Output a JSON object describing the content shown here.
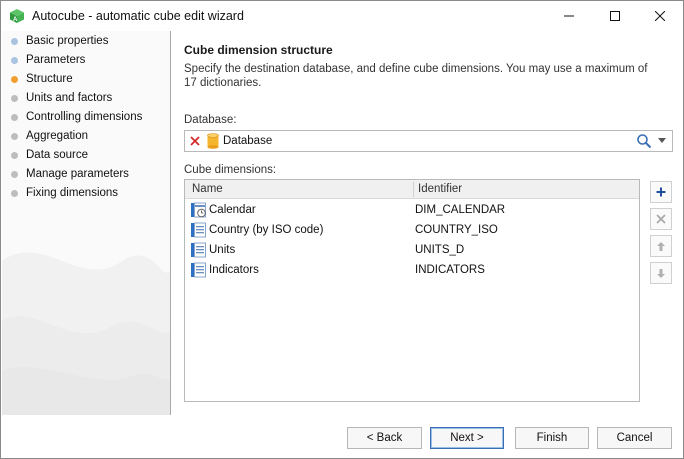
{
  "window": {
    "title": "Autocube - automatic cube edit wizard",
    "controls": [
      "minimize-icon",
      "maximize-icon",
      "close-icon"
    ]
  },
  "sidebar": {
    "items": [
      {
        "label": "Basic properties",
        "state": "done",
        "color": "#a9c3e0"
      },
      {
        "label": "Parameters",
        "state": "done",
        "color": "#a9c3e0"
      },
      {
        "label": "Structure",
        "state": "current",
        "color": "#f0a030"
      },
      {
        "label": "Units and factors",
        "state": "pending",
        "color": "#bdbdbd"
      },
      {
        "label": "Controlling dimensions",
        "state": "pending",
        "color": "#bdbdbd"
      },
      {
        "label": "Aggregation",
        "state": "pending",
        "color": "#bdbdbd"
      },
      {
        "label": "Data source",
        "state": "pending",
        "color": "#bdbdbd"
      },
      {
        "label": "Manage parameters",
        "state": "pending",
        "color": "#bdbdbd"
      },
      {
        "label": "Fixing dimensions",
        "state": "pending",
        "color": "#bdbdbd"
      }
    ]
  },
  "main": {
    "heading": "Cube dimension structure",
    "description": "Specify the destination database, and define cube dimensions. You may use a maximum of 17 dictionaries.",
    "database": {
      "label": "Database:",
      "value": "Database",
      "icons": [
        "clear-icon",
        "database-icon",
        "search-icon",
        "dropdown-arrow-icon"
      ]
    },
    "dimensions": {
      "label": "Cube dimensions:",
      "columns": [
        "Name",
        "Identifier"
      ],
      "rows": [
        {
          "name": "Calendar",
          "identifier": "DIM_CALENDAR",
          "icon": "calendar-dictionary-icon"
        },
        {
          "name": "Country (by ISO code)",
          "identifier": "COUNTRY_ISO",
          "icon": "dictionary-icon"
        },
        {
          "name": "Units",
          "identifier": "UNITS_D",
          "icon": "dictionary-icon"
        },
        {
          "name": "Indicators",
          "identifier": "INDICATORS",
          "icon": "dictionary-icon"
        }
      ],
      "side_buttons": [
        "add-icon",
        "delete-icon",
        "move-up-icon",
        "move-down-icon"
      ]
    }
  },
  "footer": {
    "back": "< Back",
    "next": "Next >",
    "finish": "Finish",
    "cancel": "Cancel"
  },
  "colors": {
    "accent": "#3a6fb5",
    "current_step": "#f0a030",
    "done_step": "#a9c3e0",
    "pending_step": "#bdbdbd"
  }
}
